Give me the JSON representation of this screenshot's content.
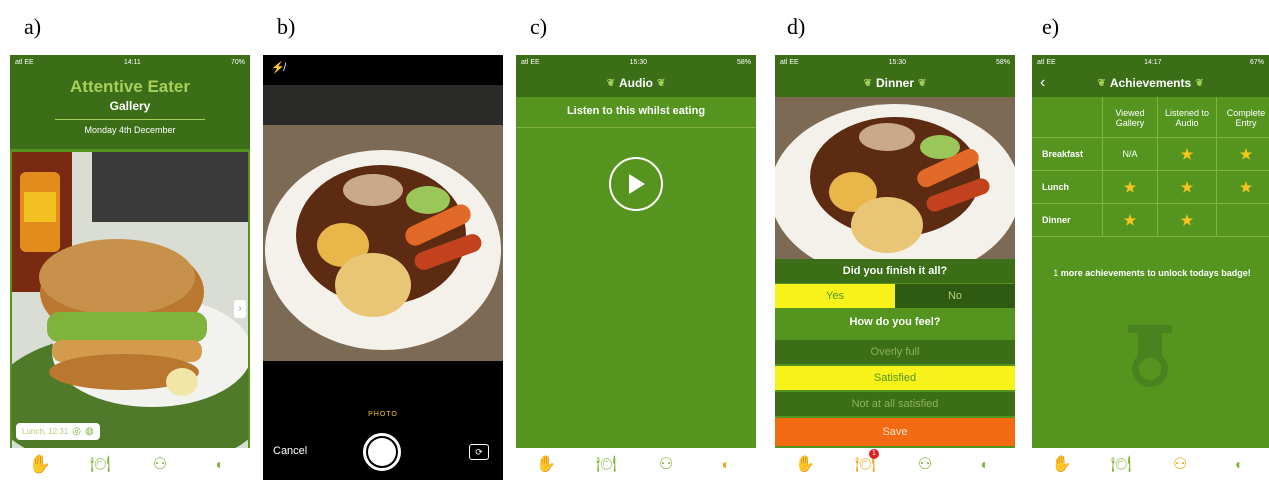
{
  "panel_labels": [
    "a)",
    "b)",
    "c)",
    "d)",
    "e)"
  ],
  "panel_a": {
    "status_left": "atl EE",
    "status_time": "14:11",
    "status_right": "70%",
    "app_title": "Attentive Eater",
    "subtitle": "Gallery",
    "date": "Monday 4th December",
    "caption": "Lunch, 12:31"
  },
  "panel_b": {
    "mode_label": "PHOTO",
    "cancel_label": "Cancel"
  },
  "panel_c": {
    "status_left": "atl EE",
    "status_time": "15:30",
    "status_right": "58%",
    "title": "Audio",
    "instruction": "Listen to this whilst eating"
  },
  "panel_d": {
    "status_left": "atl EE",
    "status_time": "15:30",
    "status_right": "58%",
    "title": "Dinner",
    "q1": "Did you finish it all?",
    "yes": "Yes",
    "no": "No",
    "q2": "How do you feel?",
    "opt1": "Overly full",
    "opt2": "Satisfied",
    "opt3": "Not at all satisfied",
    "save": "Save",
    "badge_count": "1"
  },
  "panel_e": {
    "status_left": "atl EE",
    "status_time": "14:17",
    "status_right": "67%",
    "title": "Achievements",
    "columns": [
      "Viewed Gallery",
      "Listened to Audio",
      "Complete Entry"
    ],
    "rows": [
      "Breakfast",
      "Lunch",
      "Dinner"
    ],
    "na": "N/A",
    "message_count": "1",
    "message_text": "more achievements to unlock todays badge!"
  },
  "colors": {
    "green": "#55951f",
    "dark_green": "#3b6e17",
    "yellow": "#f7f21a",
    "orange": "#f26b13"
  }
}
